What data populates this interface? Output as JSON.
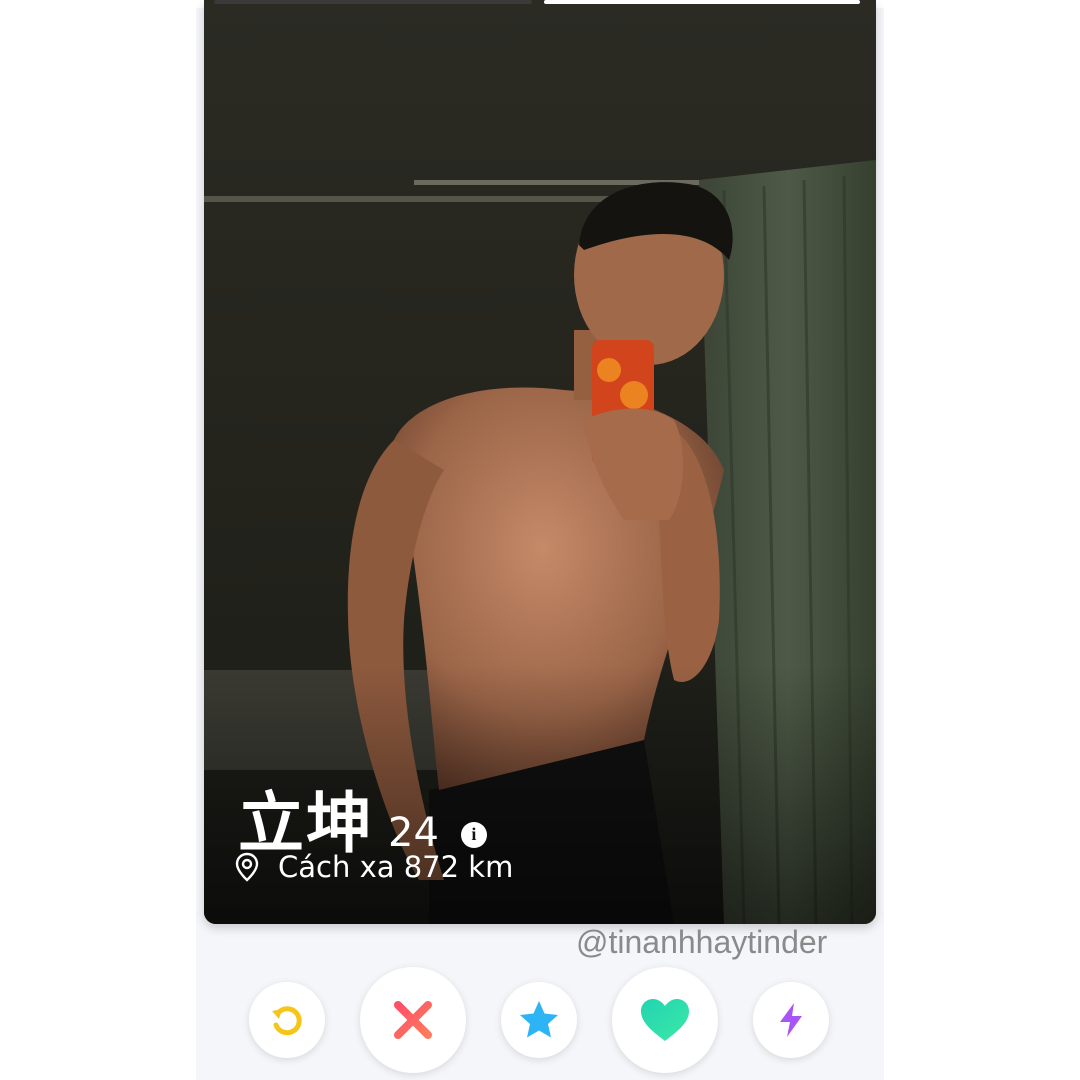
{
  "profile": {
    "name": "立坤",
    "age": "24",
    "info_icon": "info-icon",
    "distance": "Cách xa 872 km",
    "location_icon": "location-pin-icon"
  },
  "watermark": "@tinanhhaytinder",
  "actions": [
    {
      "name": "rewind",
      "icon": "rewind-icon",
      "color": "#f5c518"
    },
    {
      "name": "nope",
      "icon": "close-icon",
      "color": "#fd5068"
    },
    {
      "name": "super-like",
      "icon": "star-icon",
      "color": "#2db4f5"
    },
    {
      "name": "like",
      "icon": "heart-icon",
      "color": "#2be0b0"
    },
    {
      "name": "boost",
      "icon": "lightning-icon",
      "color": "#a855f7"
    }
  ],
  "colors": {
    "photo_indicator_active": "#ffffff",
    "photo_indicator_inactive": "#3a3a3a"
  }
}
